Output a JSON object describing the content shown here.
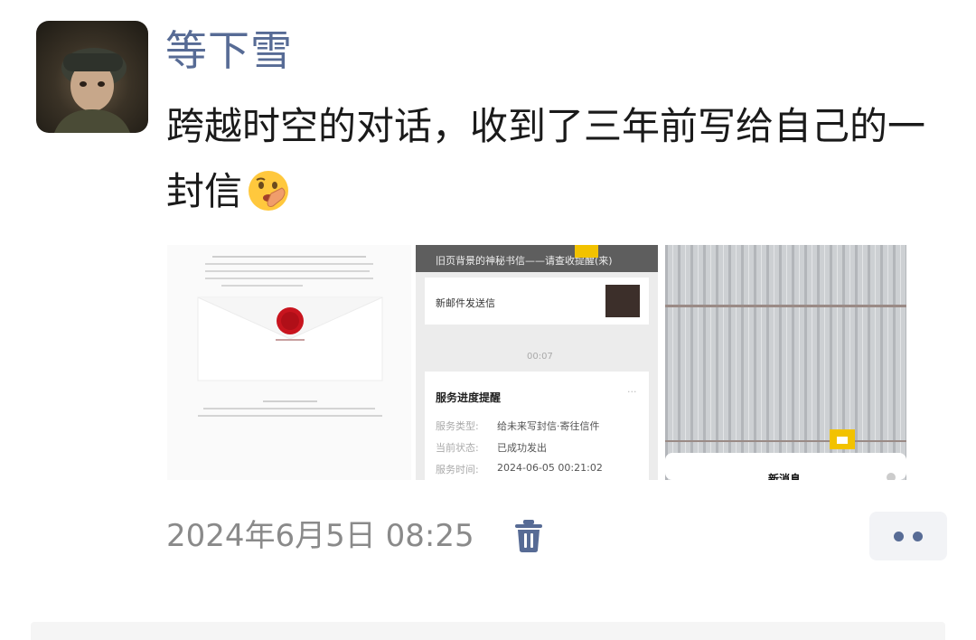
{
  "post": {
    "username": "等下雪",
    "text": "跨越时空的对话，收到了三年前写给自己的一封信",
    "emoji": "shushing-face-emoji",
    "timestamp": "2024年6月5日 08:25"
  },
  "photos": {
    "photo2": {
      "banner": "旧页背景的神秘书信——请查收提醒(来)",
      "row_label": "新邮件发送信",
      "divider_time": "00:07",
      "card_title": "服务进度提醒",
      "fields": [
        {
          "label": "服务类型:",
          "value": "给未来写封信·寄往信件"
        },
        {
          "label": "当前状态:",
          "value": "已成功发出"
        },
        {
          "label": "服务时间:",
          "value": "2024-06-05 00:21:02"
        }
      ]
    },
    "photo3": {
      "sheet_title": "新消息"
    }
  },
  "colors": {
    "name_blue": "#576b95",
    "wax_red": "#c8141e",
    "timestamp_gray": "#8a8a8a"
  }
}
